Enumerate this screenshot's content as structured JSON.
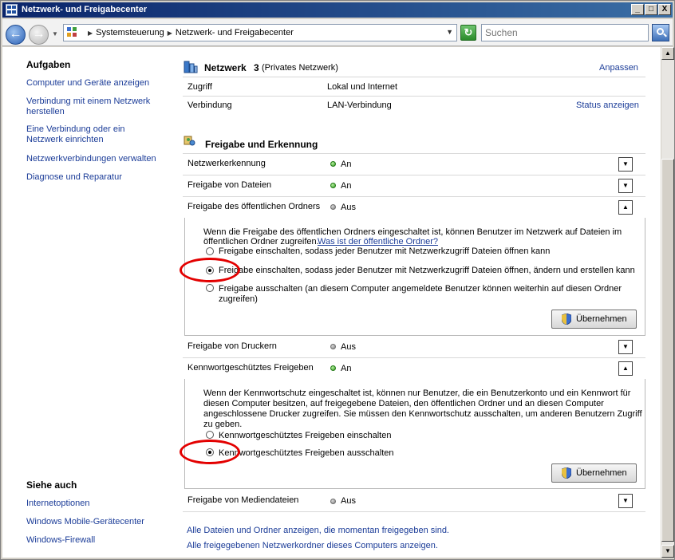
{
  "window": {
    "title": "Netzwerk- und Freigabecenter"
  },
  "titlebar_buttons": {
    "minimize": "_",
    "maximize": "□",
    "close": "X"
  },
  "address": {
    "crumbs": [
      "Systemsteuerung",
      "Netzwerk- und Freigabecenter"
    ],
    "search_placeholder": "Suchen"
  },
  "left_pane": {
    "tasks_heading": "Aufgaben",
    "tasks": [
      "Computer und Geräte anzeigen",
      "Verbindung mit einem Netzwerk herstellen",
      "Eine Verbindung oder ein Netzwerk einrichten",
      "Netzwerkverbindungen verwalten",
      "Diagnose und Reparatur"
    ],
    "see_also_heading": "Siehe auch",
    "see_also": [
      "Internetoptionen",
      "Windows Mobile-Gerätecenter",
      "Windows-Firewall"
    ]
  },
  "network": {
    "name": "Netzwerk",
    "number": "3",
    "type": "(Privates Netzwerk)",
    "customize": "Anpassen",
    "access_label": "Zugriff",
    "access_value": "Lokal und Internet",
    "connection_label": "Verbindung",
    "connection_value": "LAN-Verbindung",
    "status_link": "Status anzeigen"
  },
  "sharing": {
    "heading": "Freigabe und Erkennung",
    "rows": [
      {
        "label": "Netzwerkerkennung",
        "status": "An",
        "state": "on"
      },
      {
        "label": "Freigabe von Dateien",
        "status": "An",
        "state": "on"
      },
      {
        "label": "Freigabe des öffentlichen Ordners",
        "status": "Aus",
        "state": "off"
      },
      {
        "label": "Freigabe von Druckern",
        "status": "Aus",
        "state": "off"
      },
      {
        "label": "Kennwortgeschütztes Freigeben",
        "status": "An",
        "state": "on"
      },
      {
        "label": "Freigabe von Mediendateien",
        "status": "Aus",
        "state": "off"
      }
    ],
    "public_folder": {
      "description_1": "Wenn die Freigabe des öffentlichen Ordners eingeschaltet ist, können Benutzer im Netzwerk auf Dateien im",
      "description_2": "öffentlichen Ordner zugreifen.",
      "help_link": "Was ist der öffentliche Ordner?",
      "options": [
        "Freigabe einschalten, sodass jeder Benutzer mit Netzwerkzugriff Dateien öffnen kann",
        "Freigabe einschalten, sodass jeder Benutzer mit Netzwerkzugriff Dateien öffnen, ändern und erstellen kann",
        "Freigabe ausschalten (an diesem Computer angemeldete Benutzer können weiterhin auf diesen Ordner",
        "zugreifen)"
      ],
      "selected_index": 1,
      "apply": "Übernehmen"
    },
    "password": {
      "description": [
        "Wenn der Kennwortschutz eingeschaltet ist, können nur Benutzer, die ein Benutzerkonto und ein Kennwort für",
        "diesen Computer besitzen, auf freigegebene Dateien, den öffentlichen Ordner und an diesen Computer",
        "angeschlossene Drucker zugreifen. Sie müssen den Kennwortschutz ausschalten, um anderen Benutzern Zugriff",
        "zu geben."
      ],
      "options": [
        "Kennwortgeschütztes Freigeben einschalten",
        "Kennwortgeschütztes Freigeben ausschalten"
      ],
      "selected_index": 1,
      "apply": "Übernehmen"
    }
  },
  "footer_links": [
    "Alle Dateien und Ordner anzeigen, die momentan freigegeben sind.",
    "Alle freigegebenen Netzwerkordner dieses Computers anzeigen."
  ],
  "colors": {
    "link": "#1b3c98",
    "annotation_ring": "#e30000",
    "status_on": "#2f9a20"
  }
}
